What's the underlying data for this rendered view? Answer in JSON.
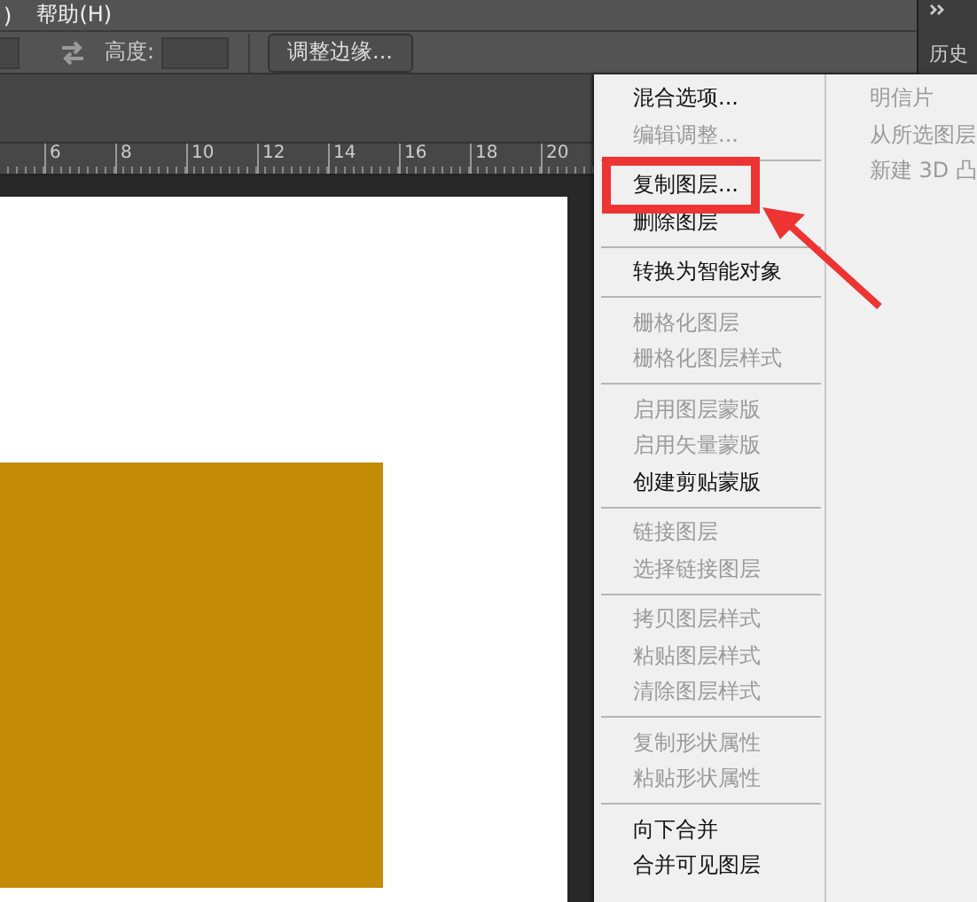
{
  "menubar": {
    "items": [
      ")",
      "帮助(H)"
    ]
  },
  "side_panel": {
    "tab": "历史"
  },
  "options_bar": {
    "height_label": "高度:",
    "refine_button": "调整边缘..."
  },
  "ruler": {
    "labels": [
      "6",
      "8",
      "10",
      "12",
      "14",
      "16",
      "18",
      "20"
    ]
  },
  "context_menu": {
    "items": [
      {
        "kind": "item",
        "label": "混合选项...",
        "disabled": false
      },
      {
        "kind": "item",
        "label": "编辑调整...",
        "disabled": true
      },
      {
        "kind": "separator"
      },
      {
        "kind": "item",
        "label": "复制图层...",
        "disabled": false
      },
      {
        "kind": "item",
        "label": "删除图层",
        "disabled": false
      },
      {
        "kind": "separator"
      },
      {
        "kind": "item",
        "label": "转换为智能对象",
        "disabled": false
      },
      {
        "kind": "separator"
      },
      {
        "kind": "item",
        "label": "栅格化图层",
        "disabled": true
      },
      {
        "kind": "item",
        "label": "栅格化图层样式",
        "disabled": true
      },
      {
        "kind": "separator"
      },
      {
        "kind": "item",
        "label": "启用图层蒙版",
        "disabled": true
      },
      {
        "kind": "item",
        "label": "启用矢量蒙版",
        "disabled": true
      },
      {
        "kind": "item",
        "label": "创建剪贴蒙版",
        "disabled": false
      },
      {
        "kind": "separator"
      },
      {
        "kind": "item",
        "label": "链接图层",
        "disabled": true
      },
      {
        "kind": "item",
        "label": "选择链接图层",
        "disabled": true
      },
      {
        "kind": "separator"
      },
      {
        "kind": "item",
        "label": "拷贝图层样式",
        "disabled": true
      },
      {
        "kind": "item",
        "label": "粘贴图层样式",
        "disabled": true
      },
      {
        "kind": "item",
        "label": "清除图层样式",
        "disabled": true
      },
      {
        "kind": "separator"
      },
      {
        "kind": "item",
        "label": "复制形状属性",
        "disabled": true
      },
      {
        "kind": "item",
        "label": "粘贴形状属性",
        "disabled": true
      },
      {
        "kind": "separator"
      },
      {
        "kind": "item",
        "label": "向下合并",
        "disabled": false
      },
      {
        "kind": "item",
        "label": "合并可见图层",
        "disabled": false
      }
    ],
    "right_items": [
      {
        "label": "明信片",
        "disabled": true
      },
      {
        "label": "从所选图层",
        "disabled": true
      },
      {
        "label": "新建 3D 凸",
        "disabled": true
      }
    ]
  }
}
